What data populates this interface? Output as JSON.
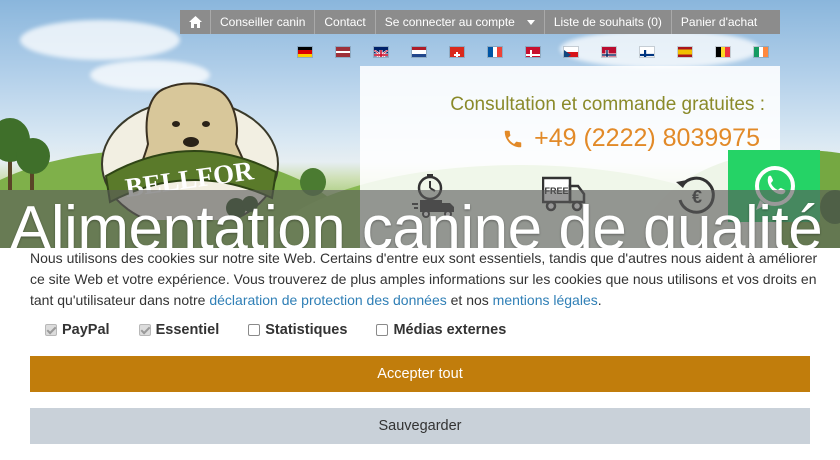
{
  "nav": {
    "items": [
      "Conseiller canin",
      "Contact",
      "Se connecter au compte",
      "Liste de souhaits (0)",
      "Panier d'achat"
    ],
    "home_icon": "home-icon"
  },
  "languages": [
    "de",
    "lv",
    "gb",
    "nl",
    "ch",
    "fr",
    "dk",
    "cz",
    "no",
    "fi",
    "es",
    "be",
    "ie"
  ],
  "contact": {
    "consultation": "Consultation et commande gratuites :",
    "phone": "+49 (2222) 8039975",
    "feature_icons": [
      "fast-delivery-icon",
      "free-shipping-icon",
      "money-back-icon"
    ]
  },
  "whatsapp_icon": "whatsapp-icon",
  "logo": {
    "text": "BELLFOR"
  },
  "headline": "Alimentation canine de qualité",
  "cookie": {
    "text_1": "Nous utilisons des cookies sur notre site Web. Certains d'entre eux sont essentiels, tandis que d'autres nous aident à améliorer ce site Web et votre expérience. Vous trouverez de plus amples informations sur les cookies que nous utilisons et vos droits en tant qu'utilisateur dans notre",
    "link_privacy": "déclaration de protection des données",
    "text_2": "et nos",
    "link_legal": "mentions légales",
    "text_3": ".",
    "options": [
      {
        "label": "PayPal",
        "checked": true,
        "disabled": true
      },
      {
        "label": "Essentiel",
        "checked": true,
        "disabled": true
      },
      {
        "label": "Statistiques",
        "checked": false,
        "disabled": false
      },
      {
        "label": "Médias externes",
        "checked": false,
        "disabled": false
      }
    ],
    "accept_label": "Accepter tout",
    "save_label": "Sauvegarder"
  },
  "colors": {
    "nav_bg": "#8c8c8c",
    "accent_orange": "#e28a28",
    "consult_olive": "#8a8a2a",
    "accept_button": "#c17d0c",
    "save_button": "#c9d1d9",
    "link": "#2f7fb6",
    "whatsapp": "#25d366"
  }
}
